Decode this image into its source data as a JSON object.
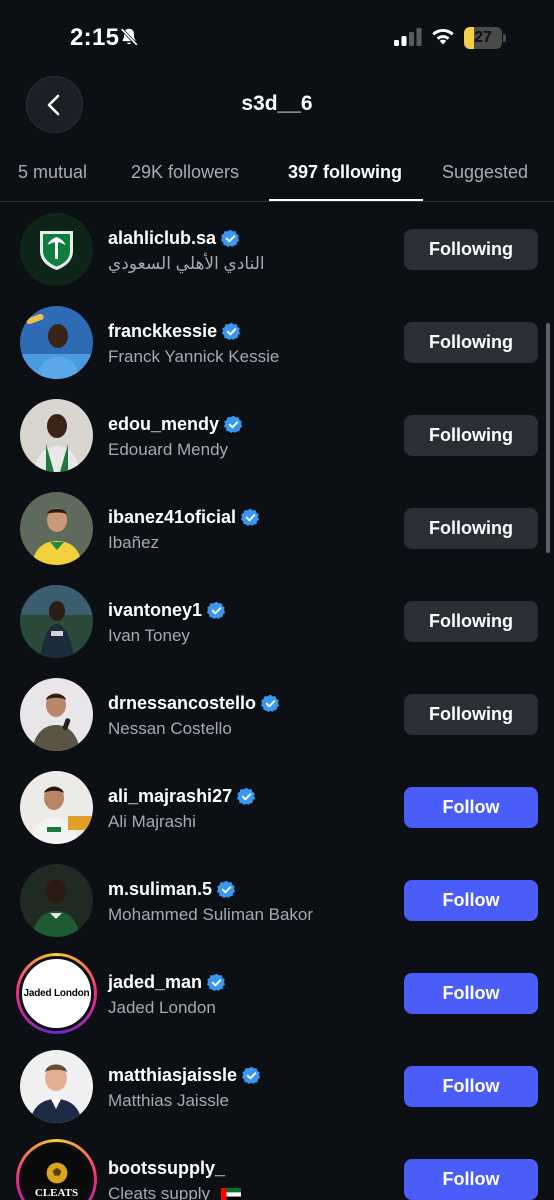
{
  "status_bar": {
    "time": "2:15",
    "battery": "27",
    "battery_level": 0.27
  },
  "header": {
    "title": "s3d__6"
  },
  "tabs": [
    {
      "label": "5 mutual",
      "active": false
    },
    {
      "label": "29K followers",
      "active": false
    },
    {
      "label": "397 following",
      "active": true
    },
    {
      "label": "Suggested",
      "active": false
    }
  ],
  "users": [
    {
      "username": "alahliclub.sa",
      "full_name": "النادي الأهلي السعودي",
      "verified": true,
      "button": "Following"
    },
    {
      "username": "franckkessie",
      "full_name": "Franck Yannick Kessie",
      "verified": true,
      "button": "Following"
    },
    {
      "username": "edou_mendy",
      "full_name": "Edouard Mendy",
      "verified": true,
      "button": "Following"
    },
    {
      "username": "ibanez41oficial",
      "full_name": "Ibañez",
      "verified": true,
      "button": "Following"
    },
    {
      "username": "ivantoney1",
      "full_name": "Ivan Toney",
      "verified": true,
      "button": "Following"
    },
    {
      "username": "drnessancostello",
      "full_name": "Nessan Costello",
      "verified": true,
      "button": "Following"
    },
    {
      "username": "ali_majrashi27",
      "full_name": "Ali Majrashi",
      "verified": true,
      "button": "Follow"
    },
    {
      "username": "m.suliman.5",
      "full_name": "Mohammed Suliman Bakor",
      "verified": true,
      "button": "Follow"
    },
    {
      "username": "jaded_man",
      "full_name": "Jaded London",
      "verified": true,
      "button": "Follow",
      "avatar_text": "Jaded London"
    },
    {
      "username": "matthiasjaissle",
      "full_name": "Matthias Jaissle",
      "verified": true,
      "button": "Follow"
    },
    {
      "username": "bootssupply_",
      "full_name": "Cleats supply",
      "verified": false,
      "button": "Follow",
      "avatar_text": "CLEATS"
    }
  ],
  "colors": {
    "background": "#0c0f14",
    "follow_button": "#4a5df9",
    "following_button": "#2a2e35",
    "verified": "#3897f0"
  }
}
